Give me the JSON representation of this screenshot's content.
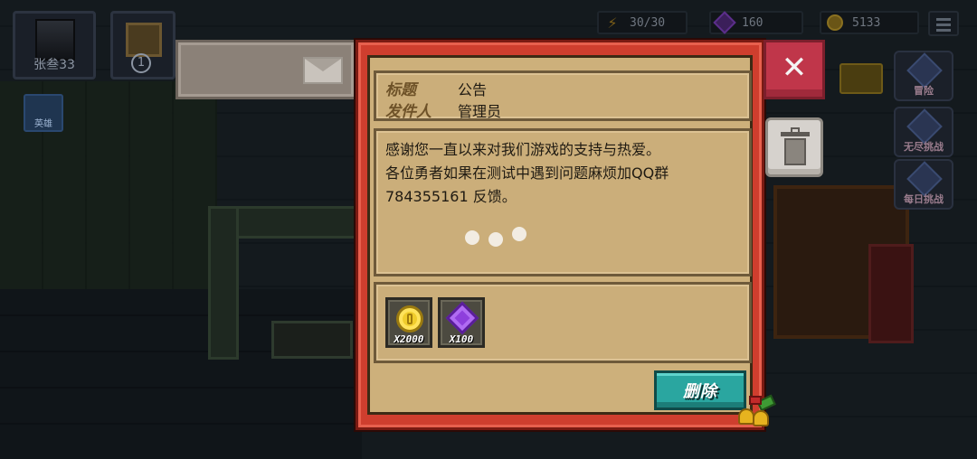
{
  "hud": {
    "player_name": "张叁33",
    "chest_badge": "1",
    "hero_label": "英雄"
  },
  "resources": {
    "energy": "30/30",
    "gems": "160",
    "gold": "5133"
  },
  "side_menu": {
    "items": [
      {
        "label": "冒险"
      },
      {
        "label": "无尽挑战"
      },
      {
        "label": "每日挑战"
      }
    ]
  },
  "mail": {
    "title_key": "标题",
    "title_value": "公告",
    "sender_key": "发件人",
    "sender_value": "管理员",
    "body_lines": [
      "感谢您一直以来对我们游戏的支持与热爱。",
      "各位勇者如果在测试中遇到问题麻烦加QQ群",
      "784355161 反馈。"
    ],
    "attachments": [
      {
        "icon": "gold-coin-icon",
        "count": "X2000"
      },
      {
        "icon": "purple-gem-icon",
        "count": "X100"
      }
    ],
    "delete_label": "删除"
  },
  "colors": {
    "dialog_border": "#cf3e2e",
    "parchment": "#cdb07b",
    "delete_button": "#2aa6a0",
    "close_button": "#c0364a"
  }
}
